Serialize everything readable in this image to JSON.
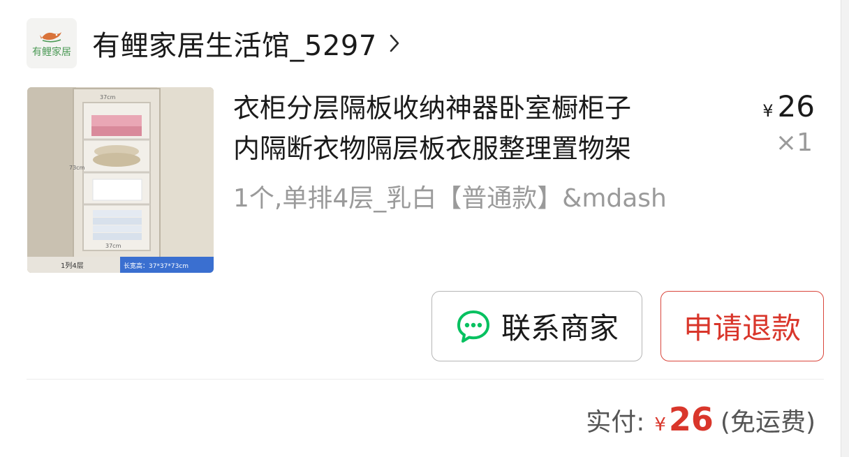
{
  "shop": {
    "logo_text": "有鲤家居",
    "name": "有鲤家居生活馆_5297"
  },
  "product": {
    "title_line1": "衣柜分层隔板收纳神器卧室橱柜子",
    "title_line2": "内隔断衣物隔层板衣服整理置物架",
    "spec": "1个,单排4层_乳白【普通款】&mdash",
    "price_currency": "¥",
    "price": "26",
    "quantity": "×1",
    "image_caption_left": "1列4层",
    "image_caption_right": "长宽高：37*37*73cm",
    "image_dim_top": "37cm",
    "image_dim_side": "73cm",
    "image_dim_bottom": "37cm"
  },
  "actions": {
    "contact_label": "联系商家",
    "refund_label": "申请退款"
  },
  "summary": {
    "paid_label": "实付:",
    "currency": "¥",
    "amount": "26",
    "note": "(免运费)"
  },
  "colors": {
    "accent_red": "#d9362b",
    "wechat_green": "#07c160",
    "text_primary": "#1a1a1a",
    "text_secondary": "#9a9a9a"
  },
  "icons": {
    "shop_chevron": "chevron-right-icon",
    "contact": "chat-bubble-icon"
  }
}
